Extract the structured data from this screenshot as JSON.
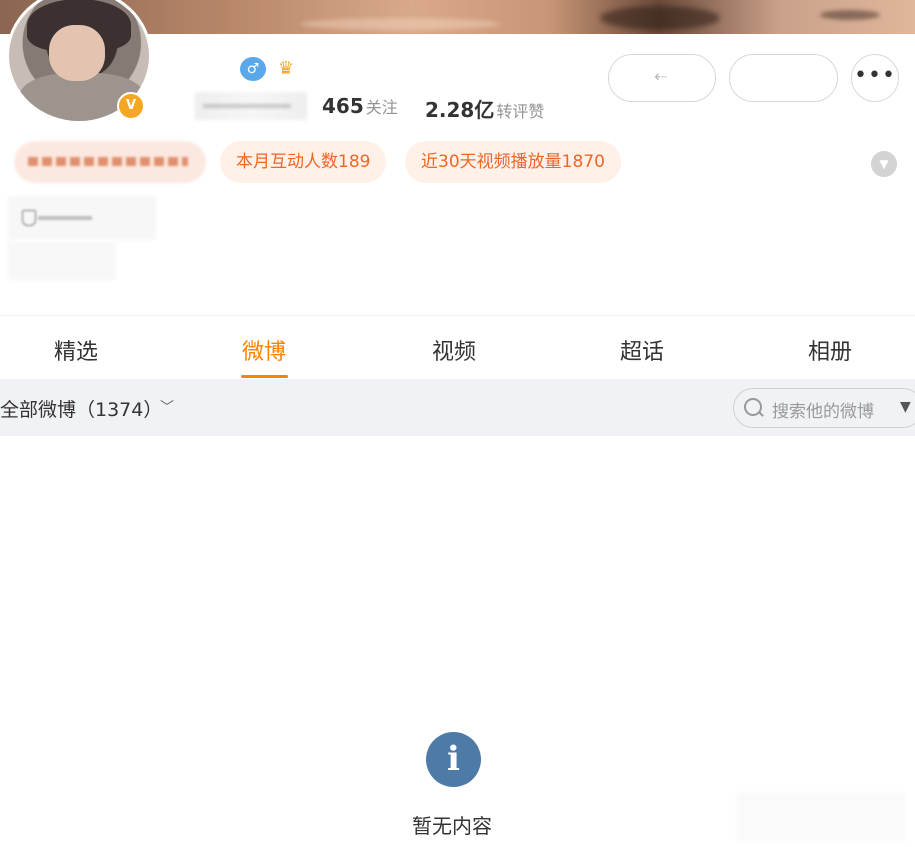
{
  "profile": {
    "stats": {
      "following_count": "465",
      "following_label": "关注",
      "likes_count": "2.28亿",
      "likes_label": "转评赞"
    },
    "verified_badge": "V",
    "gender_icon": "male-icon",
    "vip_icon": "crown-icon"
  },
  "tags": [
    "本月互动人数189",
    "近30天视频播放量1870"
  ],
  "tabs": [
    {
      "label": "精选",
      "active": false
    },
    {
      "label": "微博",
      "active": true
    },
    {
      "label": "视频",
      "active": false
    },
    {
      "label": "超话",
      "active": false
    },
    {
      "label": "相册",
      "active": false
    }
  ],
  "filter": {
    "label": "全部微博（1374）",
    "search_placeholder": "搜索他的微博"
  },
  "empty_state": {
    "icon": "info-icon",
    "message": "暂无内容"
  },
  "colors": {
    "accent": "#ff8200",
    "tag_text": "#f06624",
    "tag_bg": "#fff0e8",
    "info_icon": "#4e7aa8",
    "filter_bar_bg": "#f1f2f5"
  }
}
